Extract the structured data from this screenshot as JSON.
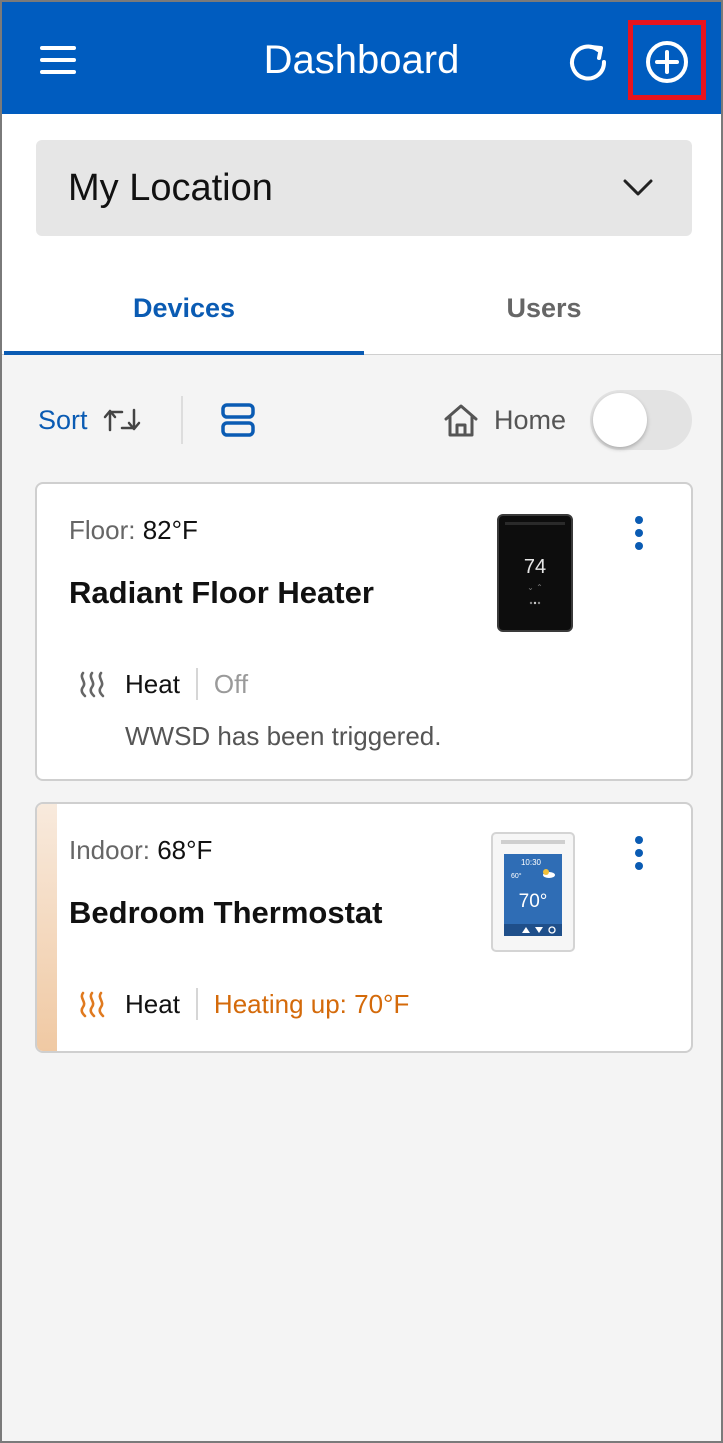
{
  "header": {
    "title": "Dashboard",
    "background": "#005cbf",
    "icons": [
      "menu-icon",
      "refresh-icon",
      "add-circle-icon"
    ],
    "highlight_color": "#e8141e"
  },
  "location": {
    "selected": "My Location"
  },
  "tabs": [
    {
      "label": "Devices",
      "active": true
    },
    {
      "label": "Users",
      "active": false
    }
  ],
  "toolbar": {
    "sort_label": "Sort",
    "home_label": "Home",
    "home_toggle_on": false
  },
  "devices": [
    {
      "temp_label": "Floor:",
      "temp_value": "82°F",
      "name": "Radiant Floor Heater",
      "mode": "Heat",
      "status": "Off",
      "message": "WWSD has been triggered.",
      "display_value": "74"
    },
    {
      "temp_label": "Indoor:",
      "temp_value": "68°F",
      "name": "Bedroom Thermostat",
      "mode": "Heat",
      "status": "Heating up: 70°F",
      "display_value": "70°",
      "display_time": "10:30",
      "display_outdoor": "60°"
    }
  ],
  "colors": {
    "accent": "#0a5bb3",
    "heating": "#d46a0a"
  }
}
